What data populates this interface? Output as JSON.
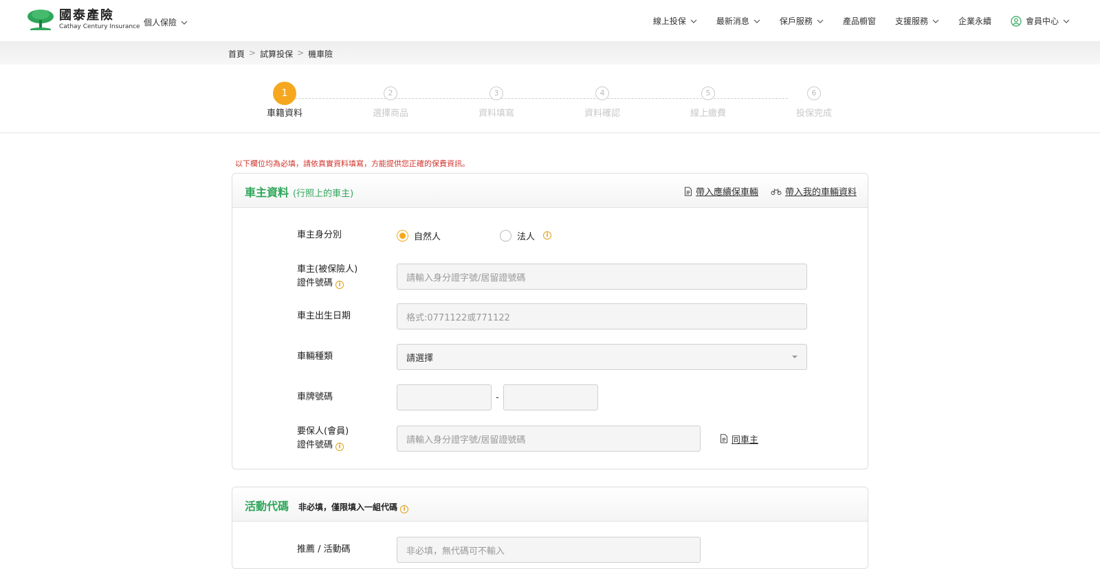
{
  "brand": {
    "name": "國泰產險",
    "en": "Cathay Century Insurance",
    "color": "#2ea65a"
  },
  "header": {
    "segment": "個人保險",
    "nav": [
      "線上投保",
      "最新消息",
      "保戶服務",
      "產品櫥窗",
      "支援服務",
      "企業永續",
      "會員中心"
    ]
  },
  "breadcrumb": [
    "首頁",
    "試算投保",
    "機車險"
  ],
  "breadcrumb_sep": ">",
  "stepper": {
    "active": 1,
    "steps": [
      {
        "num": "1",
        "label": "車籍資料"
      },
      {
        "num": "2",
        "label": "選擇商品"
      },
      {
        "num": "3",
        "label": "資料填寫"
      },
      {
        "num": "4",
        "label": "資料確認"
      },
      {
        "num": "5",
        "label": "線上繳費"
      },
      {
        "num": "6",
        "label": "投保完成"
      }
    ]
  },
  "notice": "以下欄位均為必填，請依真實資料填寫，方能提供您正確的保費資訊。",
  "owner_card": {
    "title": "車主資料",
    "subtitle": "(行照上的車主)",
    "link_renew": "帶入應續保車輛",
    "link_my_vehicle": "帶入我的車輛資料",
    "owner_type": {
      "label": "車主身分別",
      "options": [
        "自然人",
        "法人"
      ],
      "selected": "自然人"
    },
    "owner_id": {
      "label_line1": "車主(被保險人)",
      "label_line2": "證件號碼",
      "placeholder": "請輸入身分證字號/居留證號碼",
      "value": ""
    },
    "birth": {
      "label": "車主出生日期",
      "placeholder": "格式:0771122或771122",
      "value": ""
    },
    "vehicle_type": {
      "label": "車輛種類",
      "selected": "請選擇"
    },
    "plate": {
      "label": "車牌號碼",
      "part1": "",
      "part2": "",
      "sep": "-"
    },
    "applicant_id": {
      "label_line1": "要保人(會員)",
      "label_line2": "證件號碼",
      "placeholder": "請輸入身分證字號/居留證號碼",
      "value": "",
      "same_link": "同車主"
    }
  },
  "promo_card": {
    "title": "活動代碼",
    "subtitle": "非必填，僅限填入一組代碼",
    "field_label": "推薦 / 活動碼",
    "placeholder": "非必填，無代碼可不輸入"
  },
  "colors": {
    "accent": "#f5a81d",
    "notice": "#d0342c",
    "info": "#e0a21a"
  }
}
